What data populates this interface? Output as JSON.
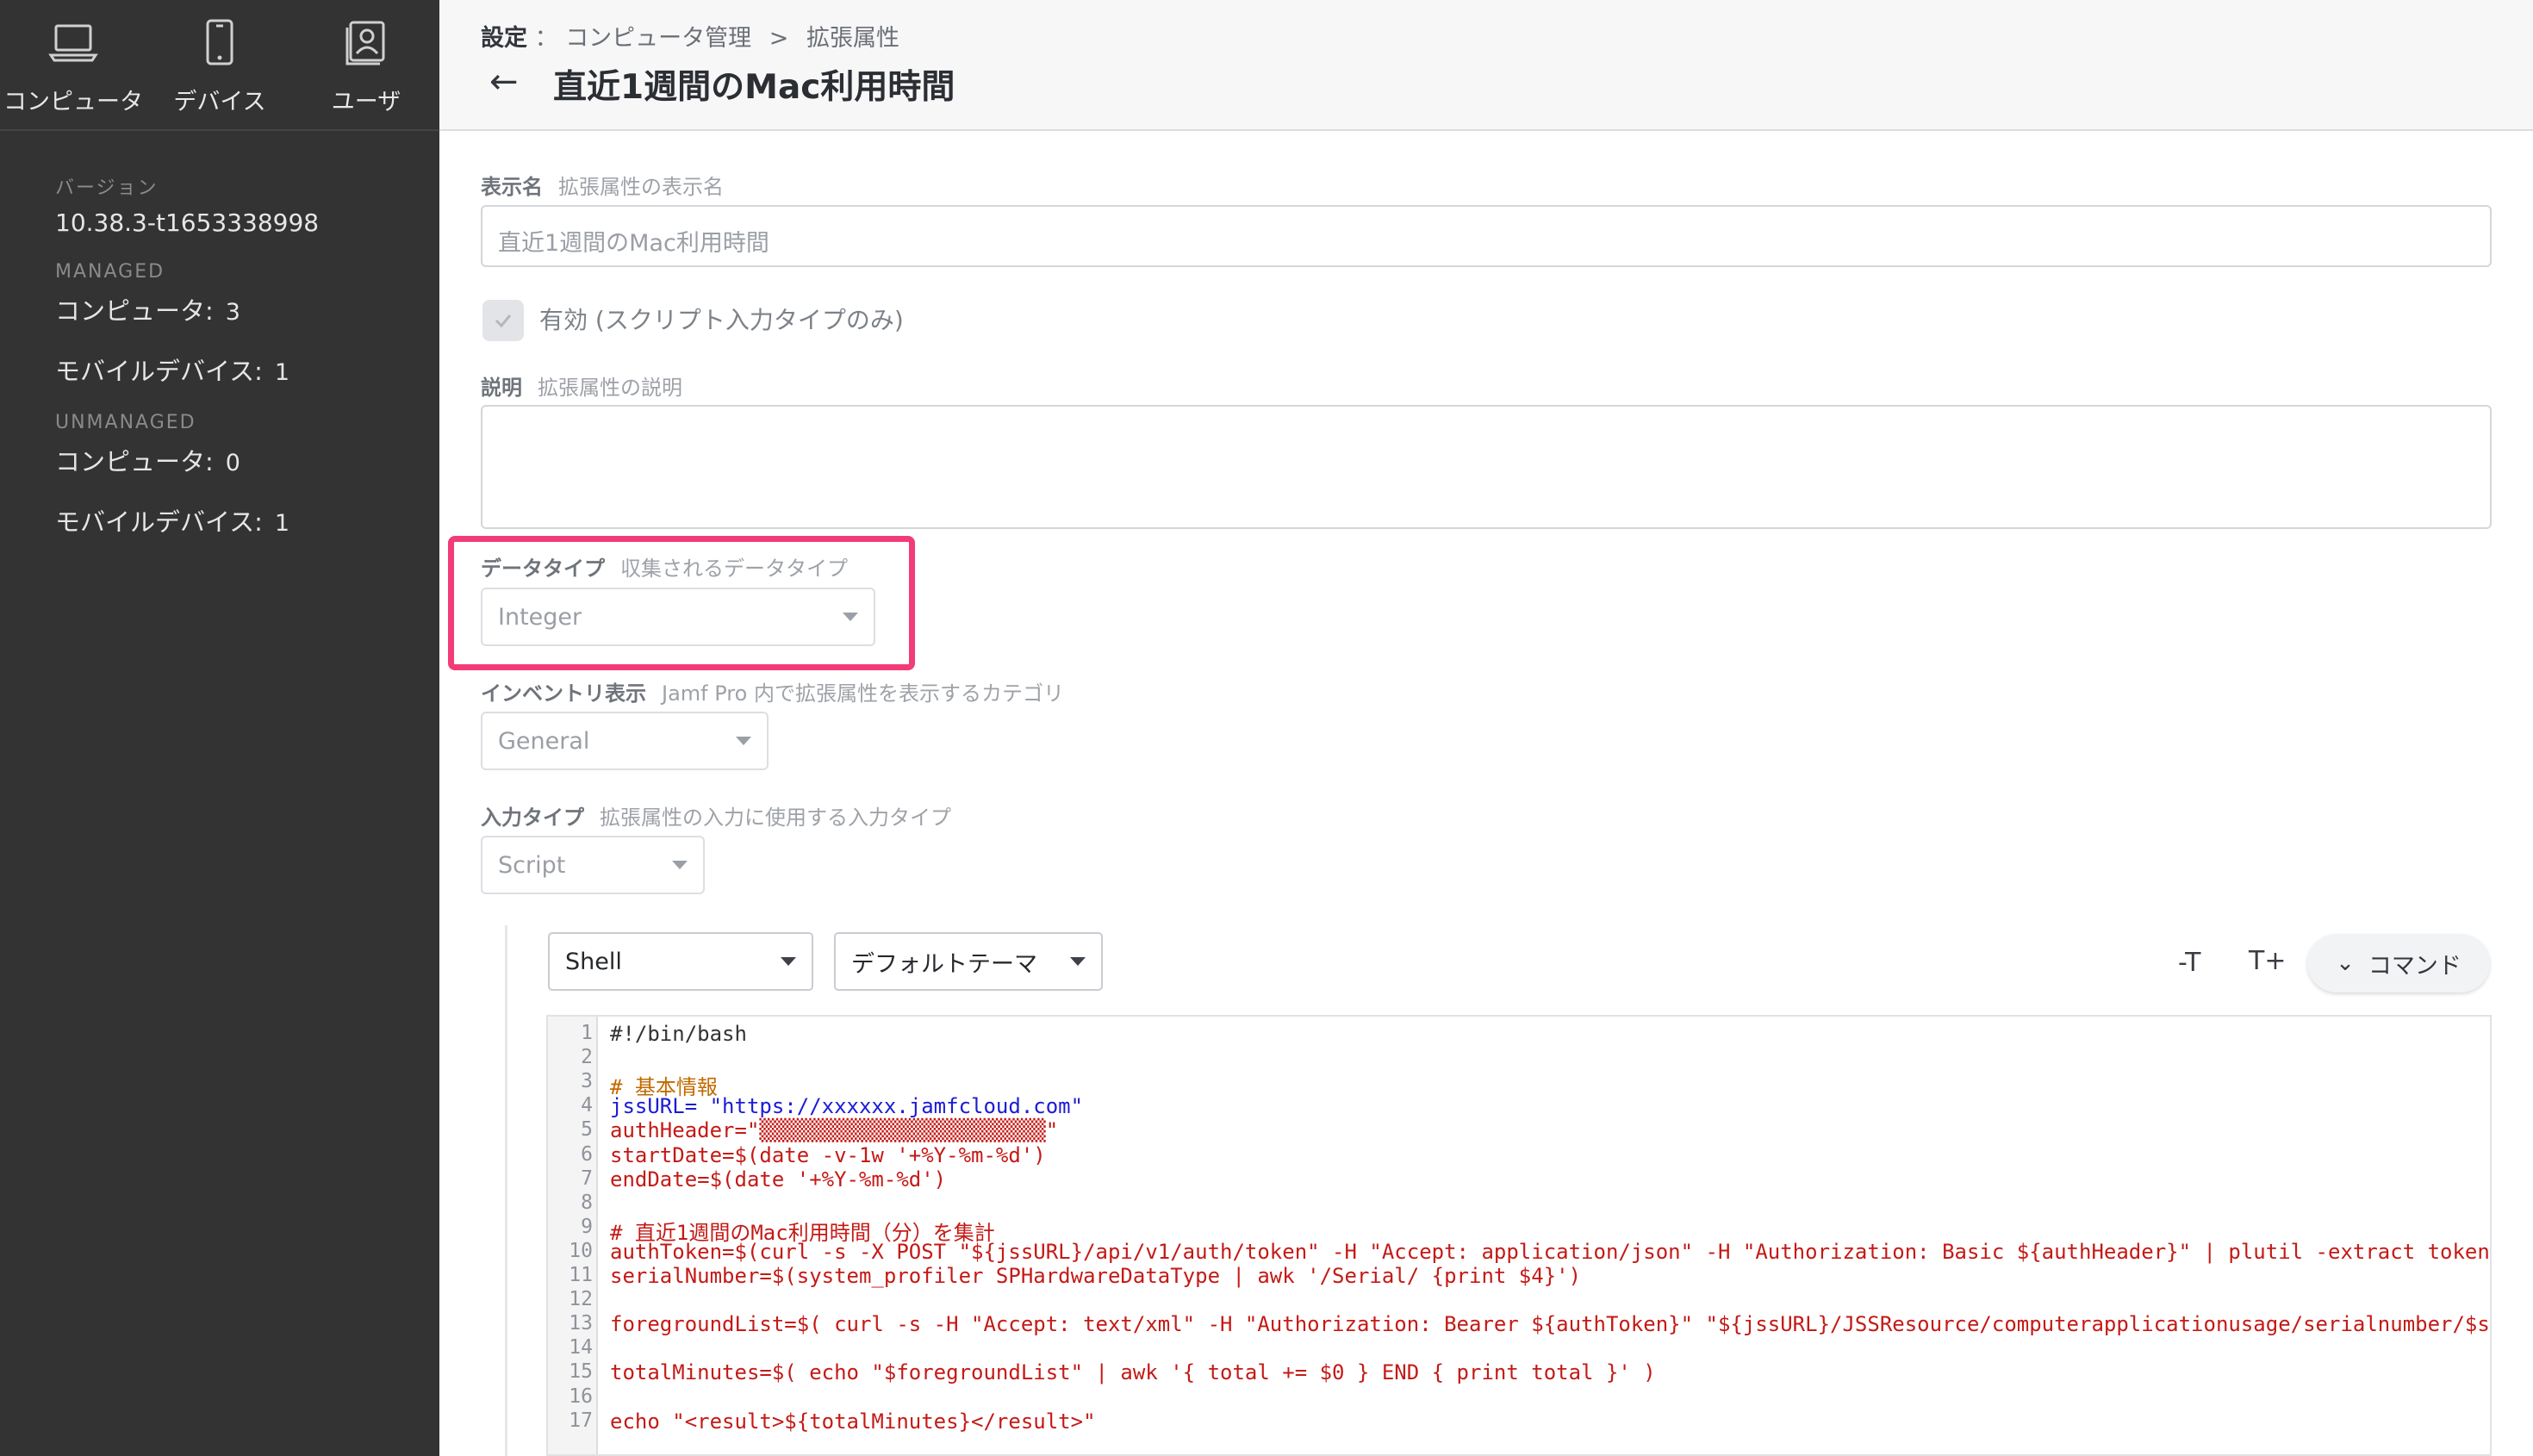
{
  "sidebar": {
    "nav": [
      {
        "label": "コンピュータ",
        "icon": "laptop-icon"
      },
      {
        "label": "デバイス",
        "icon": "mobile-device-icon"
      },
      {
        "label": "ユーザ",
        "icon": "user-icon"
      }
    ],
    "version_label": "バージョン",
    "version_value": "10.38.3-t1653338998",
    "managed_label": "MANAGED",
    "managed_computers_label": "コンピュータ:",
    "managed_computers_count": "3",
    "managed_mobile_label": "モバイルデバイス:",
    "managed_mobile_count": "1",
    "unmanaged_label": "UNMANAGED",
    "unmanaged_computers_label": "コンピュータ:",
    "unmanaged_computers_count": "0",
    "unmanaged_mobile_label": "モバイルデバイス:",
    "unmanaged_mobile_count": "1"
  },
  "header": {
    "breadcrumb_root": "設定",
    "breadcrumb_sep": "：",
    "breadcrumb_mid": "コンピュータ管理",
    "breadcrumb_arrow": ">",
    "breadcrumb_current": "拡張属性",
    "back_glyph": "←",
    "title": "直近1週間のMac利用時間"
  },
  "form": {
    "display_name_label": "表示名",
    "display_name_hint": "拡張属性の表示名",
    "display_name_value": "直近1週間のMac利用時間",
    "enabled_label": "有効 (スクリプト入力タイプのみ)",
    "description_label": "説明",
    "description_hint": "拡張属性の説明",
    "data_type_label": "データタイプ",
    "data_type_hint": "収集されるデータタイプ",
    "data_type_value": "Integer",
    "inventory_label": "インベントリ表示",
    "inventory_hint": "Jamf Pro 内で拡張属性を表示するカテゴリ",
    "inventory_value": "General",
    "input_type_label": "入力タイプ",
    "input_type_hint": "拡張属性の入力に使用する入力タイプ",
    "input_type_value": "Script"
  },
  "editor": {
    "language": "Shell",
    "theme": "デフォルトテーマ",
    "decrease_font_glyph": "-T",
    "increase_font_glyph": "T+",
    "command_label": "コマンド",
    "command_chevron": "⌄",
    "highlight_color": "#f23c78",
    "lines": [
      {
        "n": "1",
        "text": "#!/bin/bash",
        "color": "#333333"
      },
      {
        "n": "2",
        "text": "",
        "color": "#333333"
      },
      {
        "n": "3",
        "text": "# 基本情報",
        "color": "#c26a00"
      },
      {
        "n": "4",
        "text": "jssURL= \"https://xxxxxx.jamfcloud.com\"",
        "color": "#1b1bd6"
      },
      {
        "n": "5",
        "text": "authHeader=\"▒▒▒▒▒▒▒▒▒▒▒▒▒▒▒▒▒▒▒▒▒▒▒\"",
        "color": "#c41a16"
      },
      {
        "n": "6",
        "text": "startDate=$(date -v-1w '+%Y-%m-%d')",
        "color": "#c41a16"
      },
      {
        "n": "7",
        "text": "endDate=$(date '+%Y-%m-%d')",
        "color": "#c41a16"
      },
      {
        "n": "8",
        "text": "",
        "color": "#333333"
      },
      {
        "n": "9",
        "text": "# 直近1週間のMac利用時間（分）を集計",
        "color": "#c41a16"
      },
      {
        "n": "10",
        "text": "authToken=$(curl -s -X POST \"${jssURL}/api/v1/auth/token\" -H \"Accept: application/json\" -H \"Authorization: Basic ${authHeader}\" | plutil -extract token raw",
        "color": "#c41a16"
      },
      {
        "n": "11",
        "text": "serialNumber=$(system_profiler SPHardwareDataType | awk '/Serial/ {print $4}')",
        "color": "#c41a16"
      },
      {
        "n": "12",
        "text": "",
        "color": "#333333"
      },
      {
        "n": "13",
        "text": "foregroundList=$( curl -s -H \"Accept: text/xml\" -H \"Authorization: Bearer ${authToken}\" \"${jssURL}/JSSResource/computerapplicationusage/serialnumber/$serial",
        "color": "#c41a16"
      },
      {
        "n": "14",
        "text": "",
        "color": "#333333"
      },
      {
        "n": "15",
        "text": "totalMinutes=$( echo \"$foregroundList\" | awk '{ total += $0 } END { print total }' )",
        "color": "#c41a16"
      },
      {
        "n": "16",
        "text": "",
        "color": "#333333"
      },
      {
        "n": "17",
        "text": "echo \"<result>${totalMinutes}</result>\"",
        "color": "#c41a16"
      }
    ]
  }
}
